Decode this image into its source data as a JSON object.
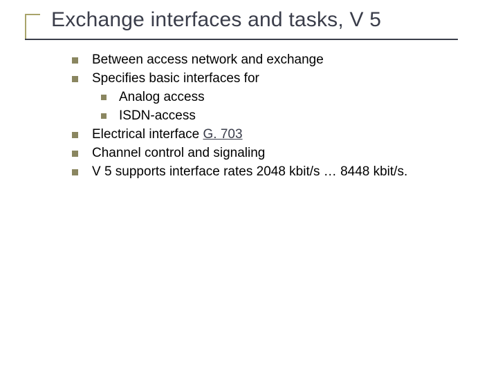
{
  "title": "Exchange interfaces and tasks, V 5",
  "items": [
    {
      "text": "Between access network and exchange"
    },
    {
      "text": "Specifies basic interfaces for"
    },
    {
      "text": "Analog access",
      "sub": true
    },
    {
      "text": "ISDN-access",
      "sub": true
    },
    {
      "pre": "Electrical interface ",
      "link": "G. 703"
    },
    {
      "text": "Channel control and signaling"
    },
    {
      "text": "V 5 supports interface rates 2048 kbit/s … 8448 kbit/s."
    }
  ]
}
